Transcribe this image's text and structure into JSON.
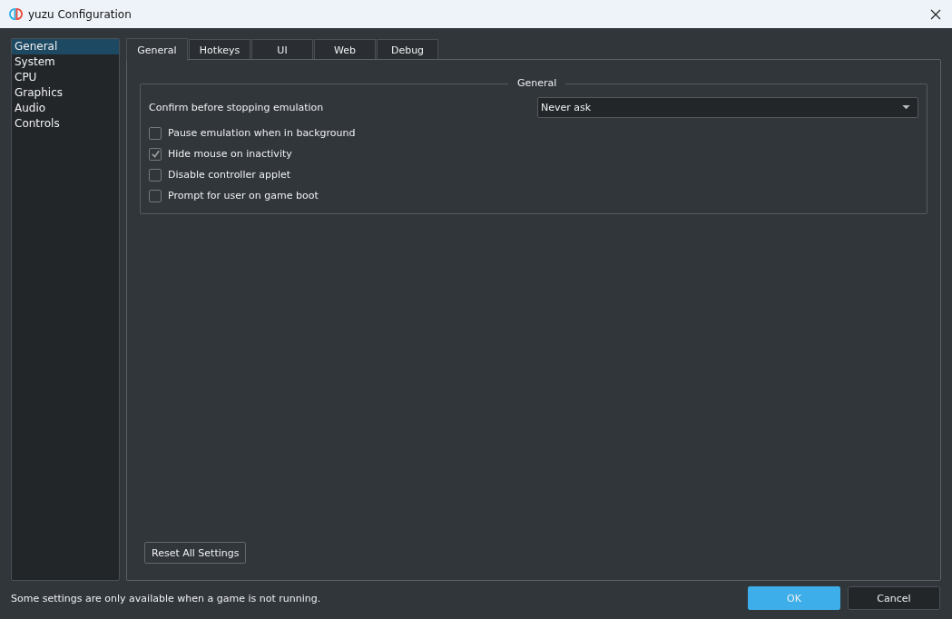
{
  "window": {
    "title": "yuzu Configuration"
  },
  "sidebar": {
    "items": [
      {
        "label": "General",
        "selected": true
      },
      {
        "label": "System",
        "selected": false
      },
      {
        "label": "CPU",
        "selected": false
      },
      {
        "label": "Graphics",
        "selected": false
      },
      {
        "label": "Audio",
        "selected": false
      },
      {
        "label": "Controls",
        "selected": false
      }
    ]
  },
  "tabs": [
    {
      "label": "General",
      "selected": true
    },
    {
      "label": "Hotkeys",
      "selected": false
    },
    {
      "label": "UI",
      "selected": false
    },
    {
      "label": "Web",
      "selected": false
    },
    {
      "label": "Debug",
      "selected": false
    }
  ],
  "group": {
    "title": "General",
    "confirm_label": "Confirm before stopping emulation",
    "confirm_value": "Never ask",
    "checkboxes": [
      {
        "label": "Pause emulation when in background",
        "checked": false
      },
      {
        "label": "Hide mouse on inactivity",
        "checked": true
      },
      {
        "label": "Disable controller applet",
        "checked": false
      },
      {
        "label": "Prompt for user on game boot",
        "checked": false
      }
    ]
  },
  "reset_button": "Reset All Settings",
  "footer": {
    "note": "Some settings are only available when a game is not running.",
    "buttons": [
      {
        "label": "OK",
        "kind": "primary"
      },
      {
        "label": "Cancel",
        "kind": "normal"
      }
    ]
  }
}
